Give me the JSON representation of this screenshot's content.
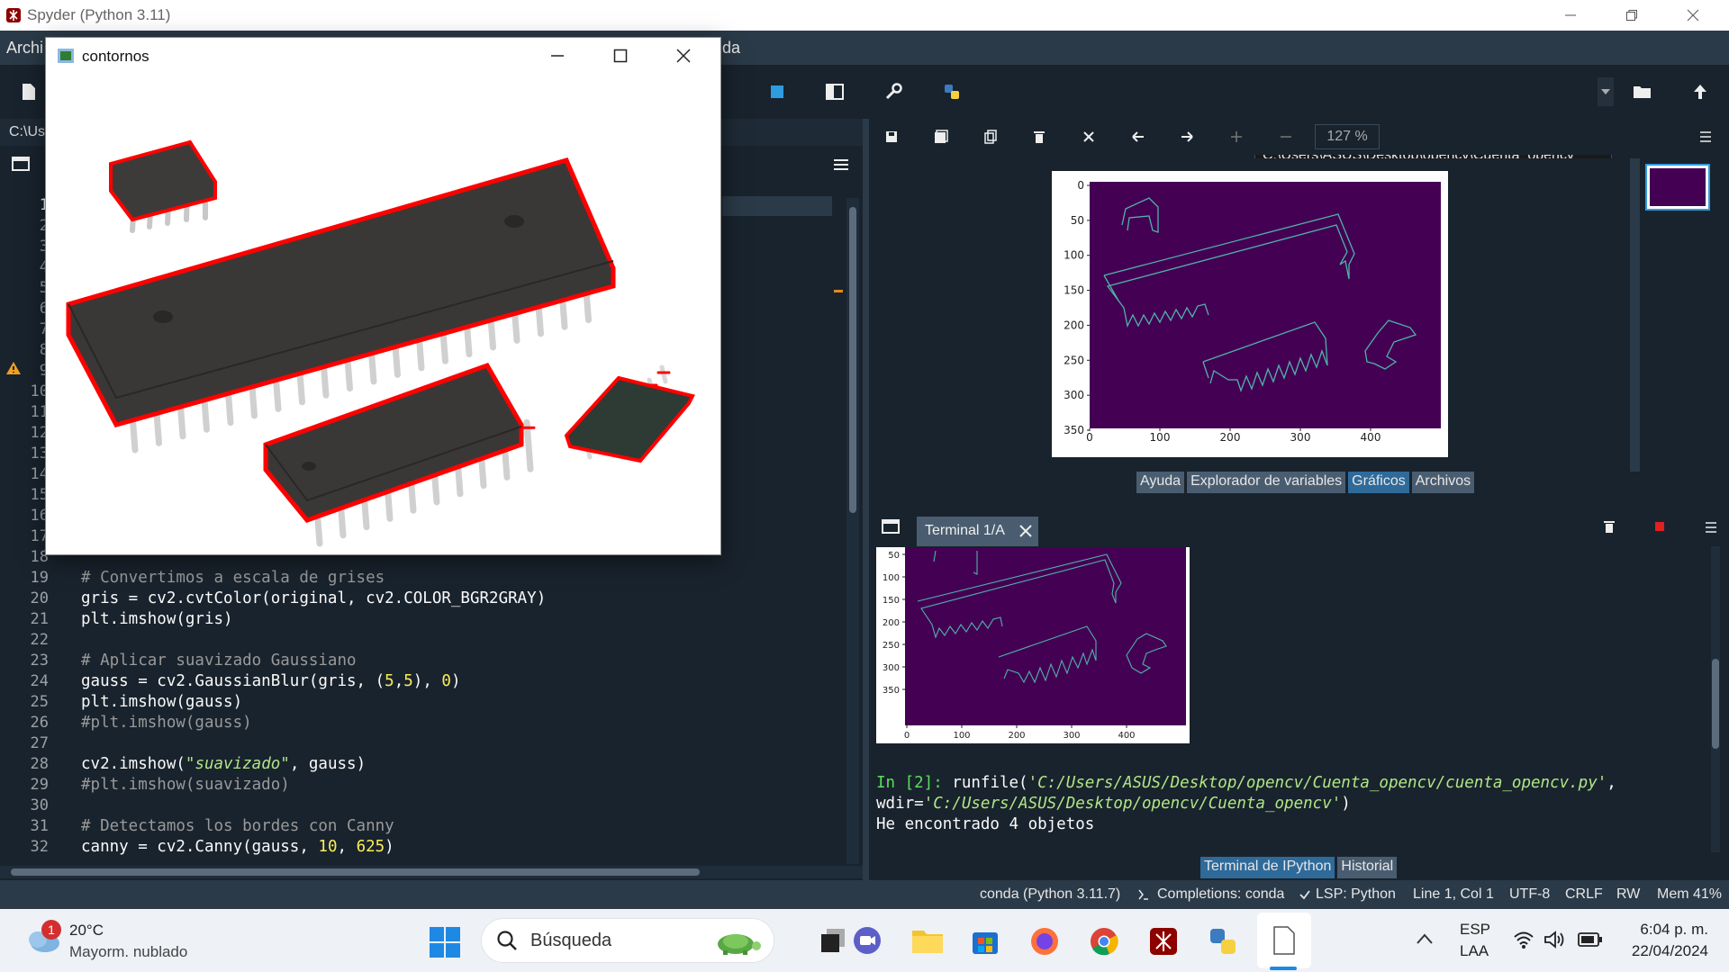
{
  "app": {
    "title": "Spyder (Python 3.11)"
  },
  "menubar": {
    "left_fragment": "Archi",
    "right_fragment": "da"
  },
  "toolbar": {
    "working_dir": "C:\\Users\\ASUS\\Desktop\\opencv\\Cuenta_opencv"
  },
  "editor": {
    "path_fragment": "C:\\Us",
    "gutter": [
      "1",
      "2",
      "3",
      "4",
      "5",
      "6",
      "7",
      "8",
      "9",
      "10",
      "11",
      "12",
      "13",
      "14",
      "15",
      "16",
      "17",
      "18",
      "19",
      "20",
      "21",
      "22",
      "23",
      "24",
      "25",
      "26",
      "27",
      "28",
      "29",
      "30",
      "31",
      "32"
    ],
    "lines": [
      {
        "n": "19",
        "code": "# Convertimos a escala de grises"
      },
      {
        "n": "20",
        "code": "gris = cv2.cvtColor(original, cv2.COLOR_BGR2GRAY)"
      },
      {
        "n": "21",
        "code": "plt.imshow(gris)"
      },
      {
        "n": "22",
        "code": ""
      },
      {
        "n": "23",
        "code": "# Aplicar suavizado Gaussiano"
      },
      {
        "n": "24",
        "code": "gauss = cv2.GaussianBlur(gris, (5,5), 0)"
      },
      {
        "n": "25",
        "code": "plt.imshow(gauss)"
      },
      {
        "n": "26",
        "code": "#plt.imshow(gauss)"
      },
      {
        "n": "27",
        "code": ""
      },
      {
        "n": "28",
        "code": "cv2.imshow(\"suavizado\", gauss)"
      },
      {
        "n": "29",
        "code": "#plt.imshow(suavizado)"
      },
      {
        "n": "30",
        "code": ""
      },
      {
        "n": "31",
        "code": "# Detectamos los bordes con Canny"
      },
      {
        "n": "32",
        "code": "canny = cv2.Canny(gauss, 10, 625)"
      }
    ]
  },
  "plots": {
    "zoom": "127 %",
    "y_ticks": [
      "0",
      "50",
      "100",
      "150",
      "200",
      "250",
      "300",
      "350"
    ],
    "x_ticks": [
      "0",
      "100",
      "200",
      "300",
      "400"
    ],
    "tabs": [
      "Ayuda",
      "Explorador de variables",
      "Gráficos",
      "Archivos"
    ],
    "active_tab": "Gráficos"
  },
  "console": {
    "tab_label": "Terminal 1/A",
    "y_ticks": [
      "50",
      "100",
      "150",
      "200",
      "250",
      "300",
      "350"
    ],
    "x_ticks": [
      "0",
      "100",
      "200",
      "300",
      "400"
    ],
    "prompt": "In [2]:",
    "cmd1": " runfile(",
    "arg1": "'C:/Users/ASUS/Desktop/opencv/Cuenta_opencv/cuenta_opencv.py'",
    "comma": ",",
    "wdir_key": "wdir=",
    "arg2": "'C:/Users/ASUS/Desktop/opencv/Cuenta_opencv'",
    "close": ")",
    "output": "He encontrado 4 objetos",
    "tabs": [
      "Terminal de IPython",
      "Historial"
    ]
  },
  "status": {
    "env": "conda (Python 3.11.7)",
    "completions": "Completions: conda",
    "lsp": "LSP: Python",
    "position": "Line 1, Col 1",
    "encoding": "UTF-8",
    "eol": "CRLF",
    "rw": "RW",
    "mem": "Mem 41%"
  },
  "contornos_window": {
    "title": "contornos"
  },
  "taskbar": {
    "weather_temp": "20°C",
    "weather_desc": "Mayorm. nublado",
    "weather_badge": "1",
    "search_placeholder": "Búsqueda",
    "lang1": "ESP",
    "lang2": "LAA",
    "time": "6:04 p. m.",
    "date": "22/04/2024"
  },
  "colors": {
    "accent": "#2e6a9a",
    "plot_bg": "#440154",
    "edge": "#4fb3a8",
    "contour": "#ff0000"
  }
}
